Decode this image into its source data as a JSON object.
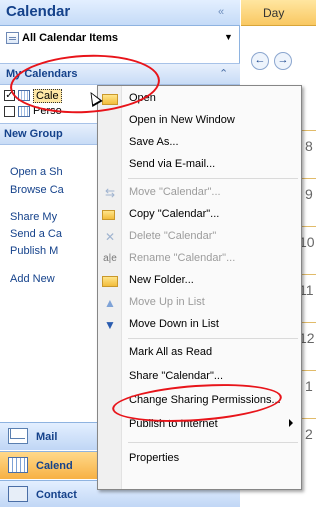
{
  "nav": {
    "title": "Calendar",
    "collapse_glyph": "«",
    "all_items_label": "All Calendar Items",
    "dropdown_glyph": "▼",
    "my_calendars_label": "My Calendars",
    "my_calendars_chevron": "⌃",
    "calendars": [
      {
        "label": "Cale",
        "checked": true
      },
      {
        "label": "Perso",
        "checked": false
      }
    ],
    "new_group_label": "New Group",
    "links": [
      "Open a Sh",
      "Browse Ca",
      "Share My",
      "Send a Ca",
      "Publish M",
      "Add New"
    ],
    "bottom_buttons": [
      "Mail",
      "Calend",
      "Contact"
    ]
  },
  "dayview": {
    "tab_label": "Day",
    "prev_glyph": "←",
    "next_glyph": "→",
    "hour_fragments": [
      "8",
      "9",
      "10",
      "11",
      "12",
      "1",
      "2"
    ]
  },
  "menu": {
    "items": [
      {
        "label": "Open",
        "icon": "calendar-open-icon",
        "enabled": true
      },
      {
        "label": "Open in New Window",
        "icon": "",
        "enabled": true
      },
      {
        "label": "Save As...",
        "icon": "",
        "enabled": true
      },
      {
        "label": "Send via E-mail...",
        "icon": "",
        "enabled": true
      },
      {
        "label": "Move \"Calendar\"...",
        "icon": "move-icon",
        "enabled": false
      },
      {
        "label": "Copy \"Calendar\"...",
        "icon": "copy-icon",
        "enabled": true
      },
      {
        "label": "Delete \"Calendar\"",
        "icon": "delete-icon",
        "enabled": false
      },
      {
        "label": "Rename \"Calendar\"...",
        "icon": "rename-icon",
        "enabled": false
      },
      {
        "label": "New Folder...",
        "icon": "new-folder-icon",
        "enabled": true
      },
      {
        "label": "Move Up in List",
        "icon": "arrow-up-icon",
        "enabled": false
      },
      {
        "label": "Move Down in List",
        "icon": "arrow-down-icon",
        "enabled": true
      },
      {
        "label": "Mark All as Read",
        "icon": "",
        "enabled": true
      },
      {
        "label": "Share \"Calendar\"...",
        "icon": "",
        "enabled": true
      },
      {
        "label": "Change Sharing Permissions...",
        "icon": "",
        "enabled": true
      },
      {
        "label": "Publish to Internet",
        "icon": "",
        "enabled": true,
        "submenu": true
      },
      {
        "label": "Properties",
        "icon": "",
        "enabled": true
      }
    ]
  },
  "colors": {
    "annotation": "#e8141a",
    "nav_header": "#c5dbf7",
    "active_button": "#f7b144",
    "title_text": "#15428b"
  }
}
